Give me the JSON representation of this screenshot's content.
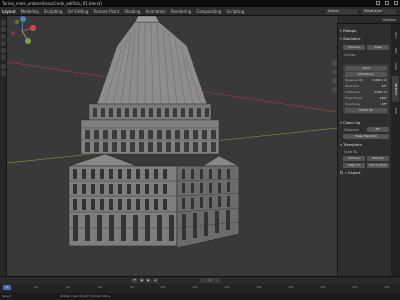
{
  "window": {
    "title": "Torino_mole_antonelliana/Cedo_edificio_01.blend]"
  },
  "menu": {
    "items": [
      "Layout",
      "Modeling",
      "Sculpting",
      "UV Editing",
      "Texture Paint",
      "Shading",
      "Animation",
      "Rendering",
      "Compositing",
      "Scripting"
    ],
    "active_index": 0
  },
  "header_right": {
    "scene": "Scene",
    "view_layer": "ViewLayer"
  },
  "outliner": {
    "label": "Options"
  },
  "n_panel": {
    "tabs": [
      "Item",
      "Tool",
      "View",
      "3D-Print",
      "Edit"
    ],
    "retopoflow_head": "Retopo",
    "analyze_head": "Statistics",
    "buttons_row1": [
      "Volume",
      "Area"
    ],
    "checks_label": "Checks",
    "solid_btn": "Solid",
    "multifaces_btn": "Multifaces",
    "stats": [
      {
        "k": "Degenerate",
        "v": "0.0001 m"
      },
      {
        "k": "Distorted",
        "v": "45°"
      },
      {
        "k": "Thickness",
        "v": "0.001 m"
      },
      {
        "k": "Edge Sharp",
        "v": "160°"
      },
      {
        "k": "Overhang",
        "v": "45°"
      }
    ],
    "check_all": "Check All",
    "fix_head": "Clean Up",
    "fix_rows": [
      {
        "label": "Distorted",
        "btn": "45°"
      }
    ],
    "fix_buttons": [
      "Make Manifold"
    ],
    "transform_head": "Transform",
    "scale_label": "Scale To",
    "scale_buttons": [
      "Volume",
      "Bounds"
    ],
    "align_buttons": [
      "Align XY",
      "Put on floor"
    ],
    "export_head": "Export"
  },
  "timeline": {
    "current_frame": "1",
    "play_controls": [
      "⏮",
      "◀",
      "▶",
      "⏭"
    ],
    "ruler": [
      "0",
      "20",
      "40",
      "60",
      "80",
      "100",
      "120",
      "140",
      "160",
      "180",
      "200",
      "220",
      "240"
    ]
  },
  "statusbar": {
    "left": "Select",
    "middle": "Rotate View   Object Context Menu"
  },
  "colors": {
    "viewport_bg": "#393939",
    "building": "#8c8c8c",
    "axis_x": "#9b3b3b",
    "axis_y": "#6e8f3a",
    "accent": "#4772b3"
  },
  "icons": [
    "gizmo-x-icon",
    "gizmo-y-icon",
    "gizmo-z-icon",
    "zoom-icon",
    "hand-icon",
    "camera-icon",
    "grid-icon"
  ]
}
